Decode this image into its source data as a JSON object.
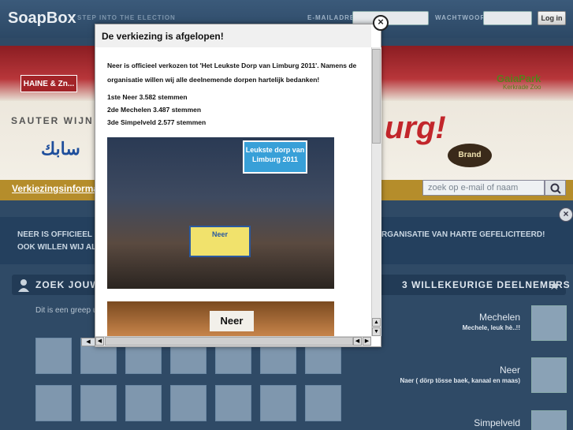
{
  "header": {
    "logo": "SoapBox",
    "step_text": "STEP INTO THE ELECTION",
    "email_label": "E-MAILADRES",
    "password_label": "WACHTWOORD",
    "login_label": "Log in"
  },
  "banner": {
    "haine": "HAINE & Zn...",
    "sauter": "SAUTER WIJN",
    "sabic": "سابك",
    "gaia": "GaiaPark",
    "gaia_sub": "Kerkrade Zoo",
    "brand": "Brand",
    "slogan": "urg!"
  },
  "nav": {
    "link": "Verkiezingsinformatie",
    "search_placeholder": "zoek op e-mail of naam"
  },
  "announcement": {
    "line1": "NEER IS OFFICIEEL",
    "line2": "OOK WILLEN WIJ AL",
    "line3": "RGANISATIE VAN HARTE GEFELICITEERD!"
  },
  "left_panel": {
    "title": "ZOEK JOUW",
    "text": "Dit is een greep u"
  },
  "right_panel": {
    "title": "3 WILLEKEURIGE DEELNEMERS",
    "participants": [
      {
        "name": "Mechelen",
        "desc": "Mechele, leuk hè..!!"
      },
      {
        "name": "Neer",
        "desc": "Naer ( dörp tösse baek, kanaal en maas)"
      },
      {
        "name": "Simpelveld",
        "desc": ""
      }
    ]
  },
  "modal": {
    "title": "De verkiezing is afgelopen!",
    "intro": "Neer is officieel verkozen tot 'Het Leukste Dorp van Limburg 2011'. Namens de organisatie willen wij alle deelnemende dorpen hartelijk bedanken!",
    "results": [
      "1ste Neer 3.582 stemmen",
      "2de Mechelen 3.487 stemmen",
      "3de Simpelveld 2.577 stemmen"
    ],
    "photo_sign": "Leukste dorp van Limburg 2011",
    "photo_banner": "Neer",
    "photo2_sign": "Neer"
  },
  "icons": {
    "close": "close-icon",
    "search": "search-icon",
    "user": "user-icon",
    "star": "star-icon"
  }
}
